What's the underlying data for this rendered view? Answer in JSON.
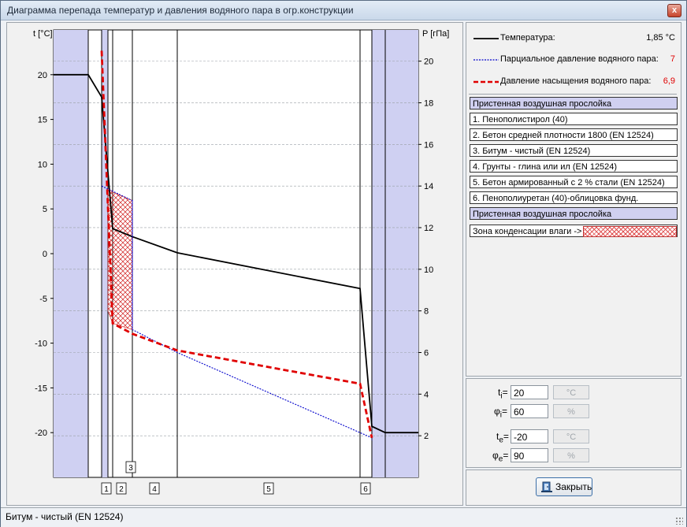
{
  "window": {
    "title": "Диаграмма перепада температур и давления водяного пара в огр.конструкции",
    "close_glyph": "x"
  },
  "chart": {
    "left_axis_label": "t [°C]",
    "right_axis_label": "P [гПа]",
    "left_ticks": [
      20,
      15,
      10,
      5,
      0,
      -5,
      -10,
      -15,
      -20
    ],
    "right_ticks": [
      20,
      18,
      16,
      14,
      12,
      10,
      8,
      6,
      4,
      2
    ],
    "layer_markers": [
      "1",
      "2",
      "3",
      "4",
      "5",
      "6"
    ]
  },
  "chart_data": {
    "type": "line",
    "left_axis": {
      "label": "t [°C]",
      "range": [
        -25,
        25
      ]
    },
    "right_axis": {
      "label": "P [гПа]",
      "range": [
        0,
        21.5
      ]
    },
    "layers": [
      "Пристенная воздушная прослойка",
      "1",
      "2",
      "3",
      "4",
      "5",
      "6",
      "Пристенная воздушная прослойка"
    ],
    "series": [
      {
        "name": "Температура",
        "axis": "left",
        "color": "#000000",
        "values": [
          20,
          20,
          17.5,
          2.8,
          1.9,
          0.1,
          -3.9,
          -19.3,
          -20,
          -20
        ]
      },
      {
        "name": "Парциальное давление водяного пара",
        "axis": "right",
        "color": "#0000cc",
        "values": [
          14.0,
          13.3,
          7.1,
          6.0,
          1.9,
          1.8
        ]
      },
      {
        "name": "Давление насыщения водяного пара",
        "axis": "right",
        "color": "#e00000",
        "values": [
          20.5,
          7.4,
          6.9,
          6.1,
          4.5,
          1.9
        ]
      }
    ]
  },
  "legend": {
    "temperature": {
      "label": "Температура:",
      "value": "1,85 °C",
      "color": "#000000"
    },
    "partial": {
      "label": "Парциальное давление водяного пара:",
      "value": "7",
      "color": "#0000cc"
    },
    "saturation": {
      "label": "Давление насыщения водяного пара:",
      "value": "6,9",
      "color": "#e00000"
    }
  },
  "layers": [
    {
      "label": "Пристенная воздушная прослойка",
      "air": true
    },
    {
      "label": "1. Пенополистирол (40)",
      "air": false
    },
    {
      "label": "2. Бетон средней плотности 1800 (EN 12524)",
      "air": false
    },
    {
      "label": "3. Битум - чистый (EN 12524)",
      "air": false
    },
    {
      "label": "4. Грунты - глина или ил (EN 12524)",
      "air": false
    },
    {
      "label": "5. Бетон армированный с 2 % стали (EN 12524)",
      "air": false
    },
    {
      "label": "6. Пенополиуретан (40)-облицовка фунд.",
      "air": false
    },
    {
      "label": "Пристенная воздушная прослойка",
      "air": true
    }
  ],
  "condensation": {
    "label": "Зона конденсации влаги ->"
  },
  "params": {
    "ti": {
      "label": "t",
      "sub": "i",
      "eq": "=",
      "value": "20",
      "unit": "°C"
    },
    "phii": {
      "label": "φ",
      "sub": "i",
      "eq": "=",
      "value": "60",
      "unit": "%"
    },
    "te": {
      "label": "t",
      "sub": "e",
      "eq": "=",
      "value": "-20",
      "unit": "°C"
    },
    "phie": {
      "label": "φ",
      "sub": "e",
      "eq": "=",
      "value": "90",
      "unit": "%"
    }
  },
  "close_button": {
    "label": "Закрыть"
  },
  "status": {
    "text": "Битум - чистый (EN 12524)"
  }
}
